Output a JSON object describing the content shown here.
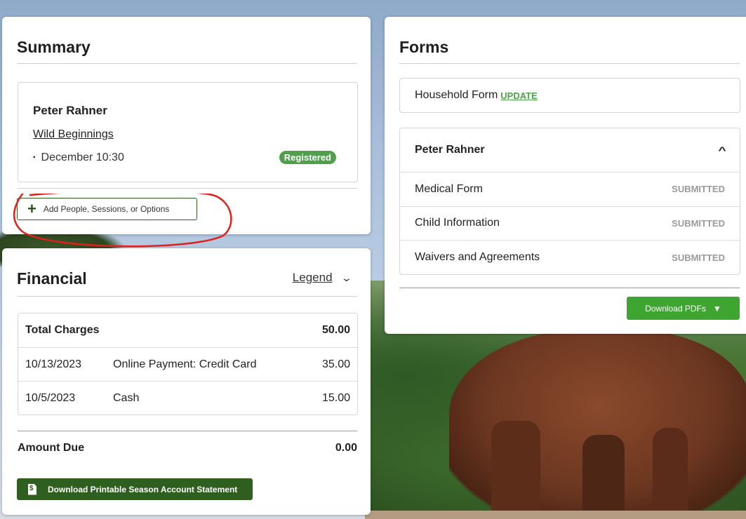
{
  "summary": {
    "title": "Summary",
    "person_name": "Peter Rahner",
    "program": "Wild Beginnings",
    "session": "December 10:30",
    "status_badge": "Registered",
    "add_button": "Add People, Sessions, or Options"
  },
  "financial": {
    "title": "Financial",
    "legend_label": "Legend",
    "total_label": "Total Charges",
    "total_value": "50.00",
    "transactions": [
      {
        "date": "10/13/2023",
        "description": "Online Payment: Credit Card",
        "amount": "35.00"
      },
      {
        "date": "10/5/2023",
        "description": "Cash",
        "amount": "15.00"
      }
    ],
    "amount_due_label": "Amount Due",
    "amount_due_value": "0.00",
    "statement_button": "Download Printable Season Account Statement"
  },
  "forms": {
    "title": "Forms",
    "household_label": "Household Form",
    "update_link": "UPDATE",
    "person_name": "Peter Rahner",
    "items": [
      {
        "name": "Medical Form",
        "status": "SUBMITTED"
      },
      {
        "name": "Child Information",
        "status": "SUBMITTED"
      },
      {
        "name": "Waivers and Agreements",
        "status": "SUBMITTED"
      }
    ],
    "download_button": "Download PDFs"
  },
  "colors": {
    "primary_green": "#2f5f1f",
    "badge_green": "#4ea04a",
    "download_green": "#3fa531",
    "annotation_red": "#e0201b"
  }
}
